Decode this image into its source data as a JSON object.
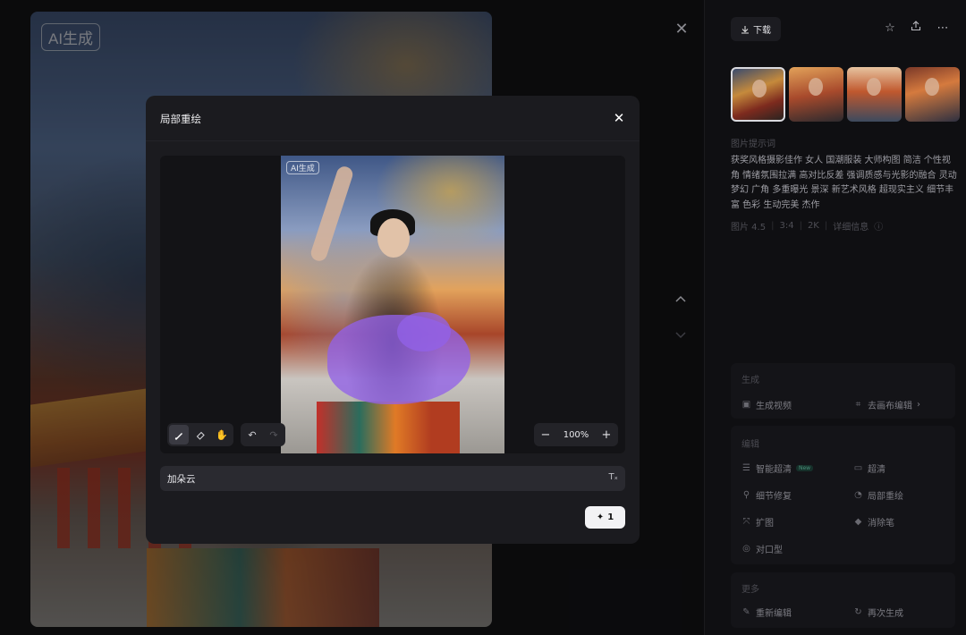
{
  "background_image": {
    "ai_label": "AI生成"
  },
  "right_panel": {
    "download_label": "下载",
    "prompt_title": "图片提示词",
    "prompt_text": "获奖风格摄影佳作 女人 国潮服装 大师构图 简洁 个性视角 情绪氛围拉满 高对比反差 强调质感与光影的融合 灵动 梦幻 广角 多重曝光 景深 新艺术风格 超现实主义 细节丰富 色彩 生动完美 杰作",
    "meta": {
      "model": "图片 4.5",
      "ratio": "3:4",
      "resolution": "2K",
      "details": "详细信息"
    },
    "sections": [
      {
        "title": "生成",
        "items": [
          "生成视频",
          "去画布编辑"
        ]
      },
      {
        "title": "编辑",
        "items": [
          "智能超清",
          "超清",
          "细节修复",
          "局部重绘",
          "扩图",
          "消除笔",
          "对口型"
        ],
        "badge": "New"
      },
      {
        "title": "更多",
        "items": [
          "重新编辑",
          "再次生成"
        ]
      }
    ]
  },
  "modal": {
    "title": "局部重绘",
    "canvas_ai_label": "AI生成",
    "zoom": "100%",
    "prompt_value": "加朵云",
    "generate_count": "1"
  },
  "icons": {
    "close": "close-icon",
    "download": "download-icon",
    "star": "star-icon",
    "share": "share-icon",
    "more": "more-icon",
    "brush": "brush-icon",
    "eraser": "eraser-icon",
    "hand": "hand-icon",
    "undo": "undo-icon",
    "redo": "redo-icon"
  },
  "colors": {
    "mask": "#9262e8",
    "modal_bg": "#1b1b1f",
    "page_bg": "#0b0b0d"
  }
}
